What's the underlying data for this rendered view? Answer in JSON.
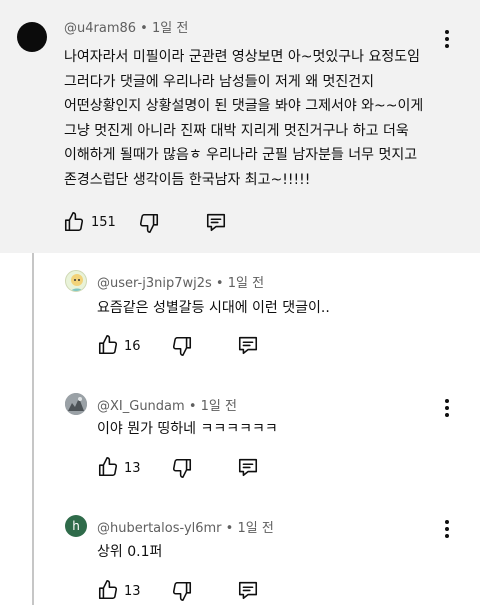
{
  "main_comment": {
    "author": "@u4ram86",
    "time": "1일 전",
    "lines": [
      "나여자라서 미필이라 군관련 영상보면 아~멋있구나 요정도임",
      "그러다가 댓글에 우리나라 남성들이 저게 왜 멋진건지",
      "어떤상황인지 상황설명이 된 댓글을 봐야 그제서야 와~~이게",
      "그냥 멋진게 아니라 진짜 대박 지리게 멋진거구나 하고 더욱",
      "이해하게 될때가 많음ㅎ 우리나라 군필 남자분들 너무 멋지고",
      "존경스럽단 생각이듬 한국남자 최고~!!!!!"
    ],
    "likes": "151"
  },
  "replies": [
    {
      "author": "@user-j3nip7wj2s",
      "time": "1일 전",
      "text": "요즘같은 성별갈등 시대에 이런 댓글이..",
      "likes": "16"
    },
    {
      "author": "@XI_Gundam",
      "time": "1일 전",
      "text": "이야 뭔가 띵하네 ㅋㅋㅋㅋㅋㅋ",
      "likes": "13"
    },
    {
      "author": "@hubertalos-yl6mr",
      "time": "1일 전",
      "text": "상위 0.1퍼",
      "likes": "13",
      "avatar_letter": "h"
    }
  ],
  "separator": " • ",
  "icons": {
    "like": "thumb-up-icon",
    "dislike": "thumb-down-icon",
    "reply": "reply-comment-icon",
    "more": "more-vert-icon"
  }
}
